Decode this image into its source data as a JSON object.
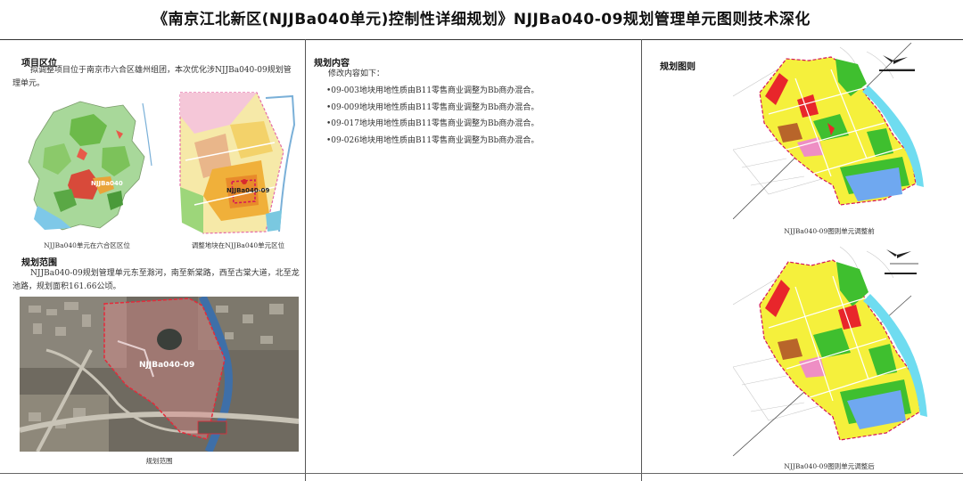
{
  "title": "《南京江北新区(NJJBa040单元)控制性详细规划》NJJBa040-09规划管理单元图则技术深化",
  "section1": {
    "heading": "项目区位",
    "text": "拟调整项目位于南京市六合区雄州组团，本次优化涉NJJBa040-09规划管理单元。",
    "map1_label": "NJJBa040",
    "map1_caption": "NJJBa040单元在六合区区位",
    "map2_label": "NJJBa040-09",
    "map2_caption": "调整地块在NJJBa040单元区位"
  },
  "section2": {
    "heading": "规划范围",
    "text": "NJJBa040-09规划管理单元东至滁河，南至新棠路，西至古棠大道，北至龙池路，规划面积161.66公顷。",
    "aerial_label": "NJJBa040-09",
    "caption": "规划范围"
  },
  "section3": {
    "heading": "规划内容",
    "intro": "修改内容如下：",
    "items": [
      "•09-003地块用地性质由B11零售商业调整为Bb商办混合。",
      "•09-009地块用地性质由B11零售商业调整为Bb商办混合。",
      "•09-017地块用地性质由B11零售商业调整为Bb商办混合。",
      "•09-026地块用地性质由B11零售商业调整为Bb商办混合。"
    ]
  },
  "section4": {
    "heading": "规划图则",
    "caption_before": "NJJBa040-09图则单元调整前",
    "caption_after": "NJJBa040-09图则单元调整后"
  },
  "colors": {
    "residential": "#f5f03c",
    "commercial": "#e8262b",
    "green": "#3fbf2f",
    "water": "#6fdcf0",
    "education": "#ee8ec4",
    "industry": "#b8652a",
    "boundary": "#d4145a"
  }
}
